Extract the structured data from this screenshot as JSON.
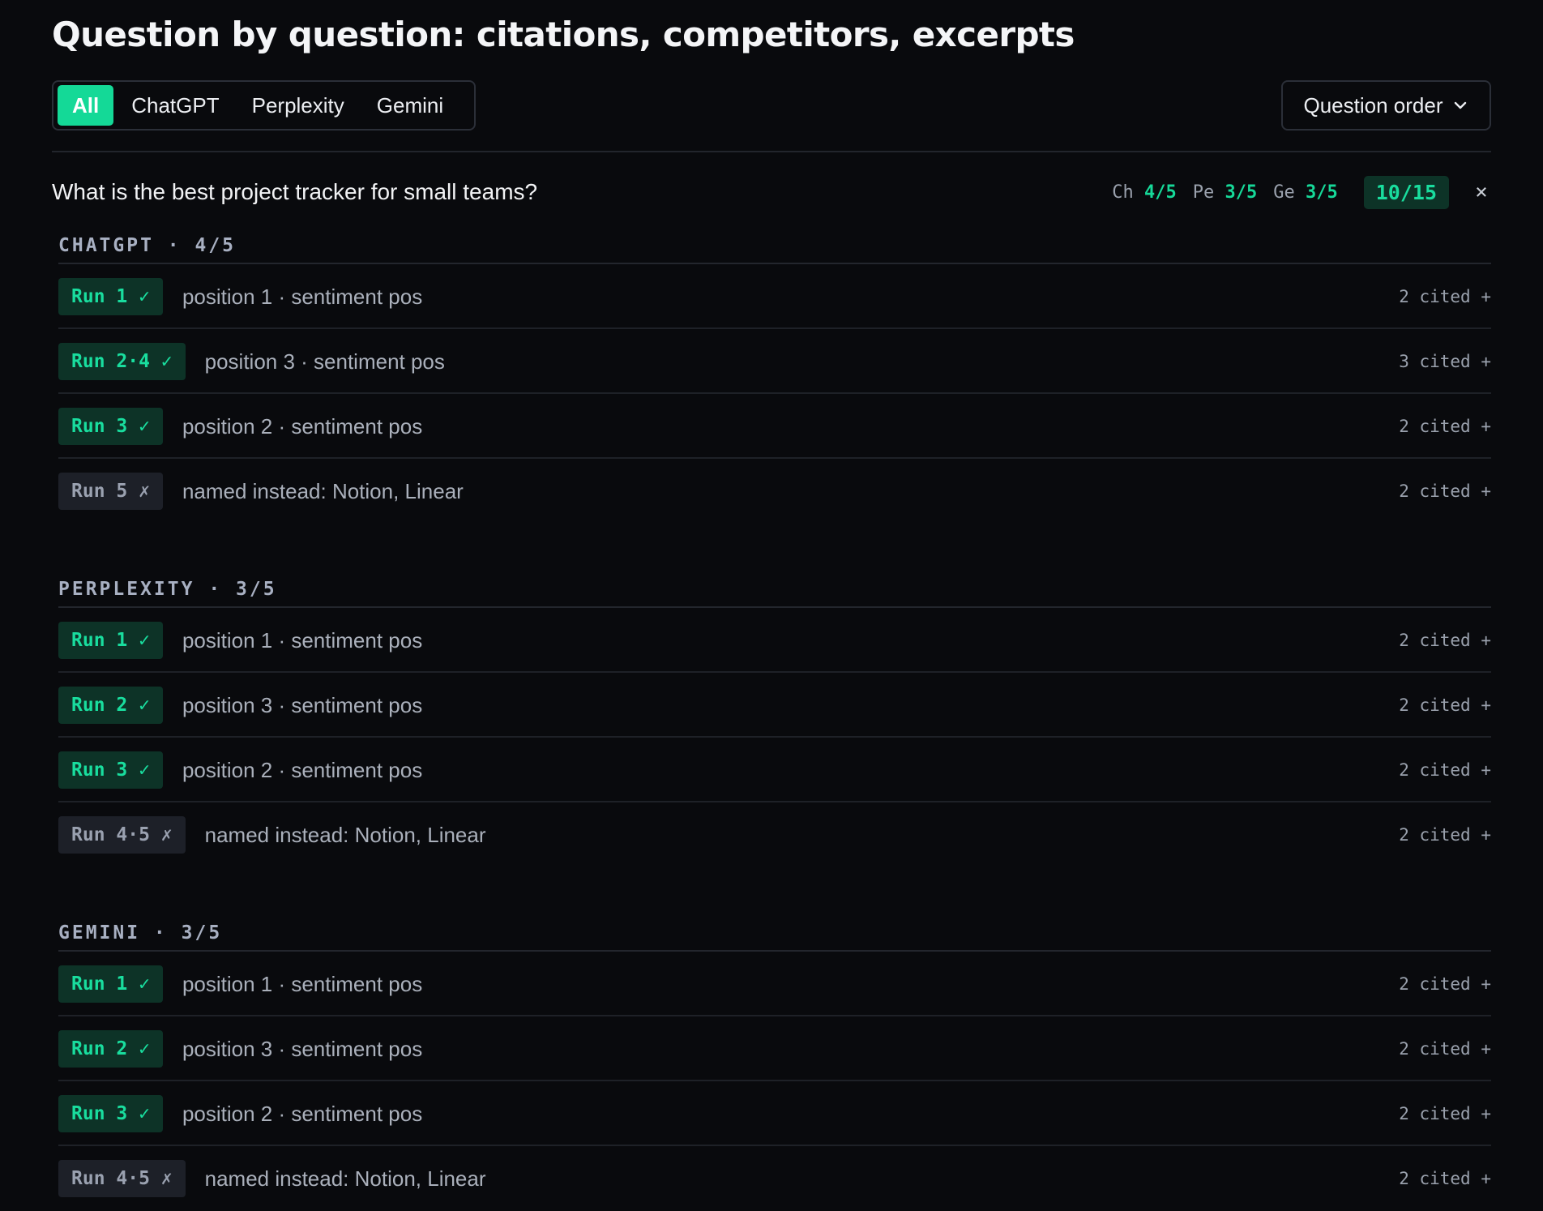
{
  "title": "Question by question: citations, competitors, excerpts",
  "filters": {
    "tabs": [
      {
        "label": "All",
        "active": true
      },
      {
        "label": "ChatGPT",
        "active": false
      },
      {
        "label": "Perplexity",
        "active": false
      },
      {
        "label": "Gemini",
        "active": false
      }
    ]
  },
  "sort": {
    "label": "Question order",
    "icon": "chevron-down-icon"
  },
  "question": {
    "text": "What is the best project tracker for small teams?",
    "scores": [
      {
        "label": "Ch",
        "value": "4/5"
      },
      {
        "label": "Pe",
        "value": "3/5"
      },
      {
        "label": "Ge",
        "value": "3/5"
      }
    ],
    "total": "10/15",
    "close_label": "×"
  },
  "sections": [
    {
      "header": "CHATGPT · 4/5",
      "runs": [
        {
          "badge": "Run 1 ✓",
          "status": "ok",
          "detail": "position 1 · sentiment pos",
          "cited": "2 cited +"
        },
        {
          "badge": "Run 2·4 ✓",
          "status": "ok",
          "detail": "position 3 · sentiment pos",
          "cited": "3 cited +"
        },
        {
          "badge": "Run 3 ✓",
          "status": "ok",
          "detail": "position 2 · sentiment pos",
          "cited": "2 cited +"
        },
        {
          "badge": "Run 5 ✗",
          "status": "miss",
          "detail": "named instead: Notion, Linear",
          "cited": "2 cited +"
        }
      ]
    },
    {
      "header": "PERPLEXITY · 3/5",
      "runs": [
        {
          "badge": "Run 1 ✓",
          "status": "ok",
          "detail": "position 1 · sentiment pos",
          "cited": "2 cited +"
        },
        {
          "badge": "Run 2 ✓",
          "status": "ok",
          "detail": "position 3 · sentiment pos",
          "cited": "2 cited +"
        },
        {
          "badge": "Run 3 ✓",
          "status": "ok",
          "detail": "position 2 · sentiment pos",
          "cited": "2 cited +"
        },
        {
          "badge": "Run 4·5 ✗",
          "status": "miss",
          "detail": "named instead: Notion, Linear",
          "cited": "2 cited +"
        }
      ]
    },
    {
      "header": "GEMINI · 3/5",
      "runs": [
        {
          "badge": "Run 1 ✓",
          "status": "ok",
          "detail": "position 1 · sentiment pos",
          "cited": "2 cited +"
        },
        {
          "badge": "Run 2 ✓",
          "status": "ok",
          "detail": "position 3 · sentiment pos",
          "cited": "2 cited +"
        },
        {
          "badge": "Run 3 ✓",
          "status": "ok",
          "detail": "position 2 · sentiment pos",
          "cited": "2 cited +"
        },
        {
          "badge": "Run 4·5 ✗",
          "status": "miss",
          "detail": "named instead: Notion, Linear",
          "cited": "2 cited +"
        }
      ]
    }
  ],
  "colors": {
    "background": "#090a0d",
    "accent": "#14d997",
    "success_bg": "#0d3327",
    "muted_badge_bg": "#1d2028"
  }
}
